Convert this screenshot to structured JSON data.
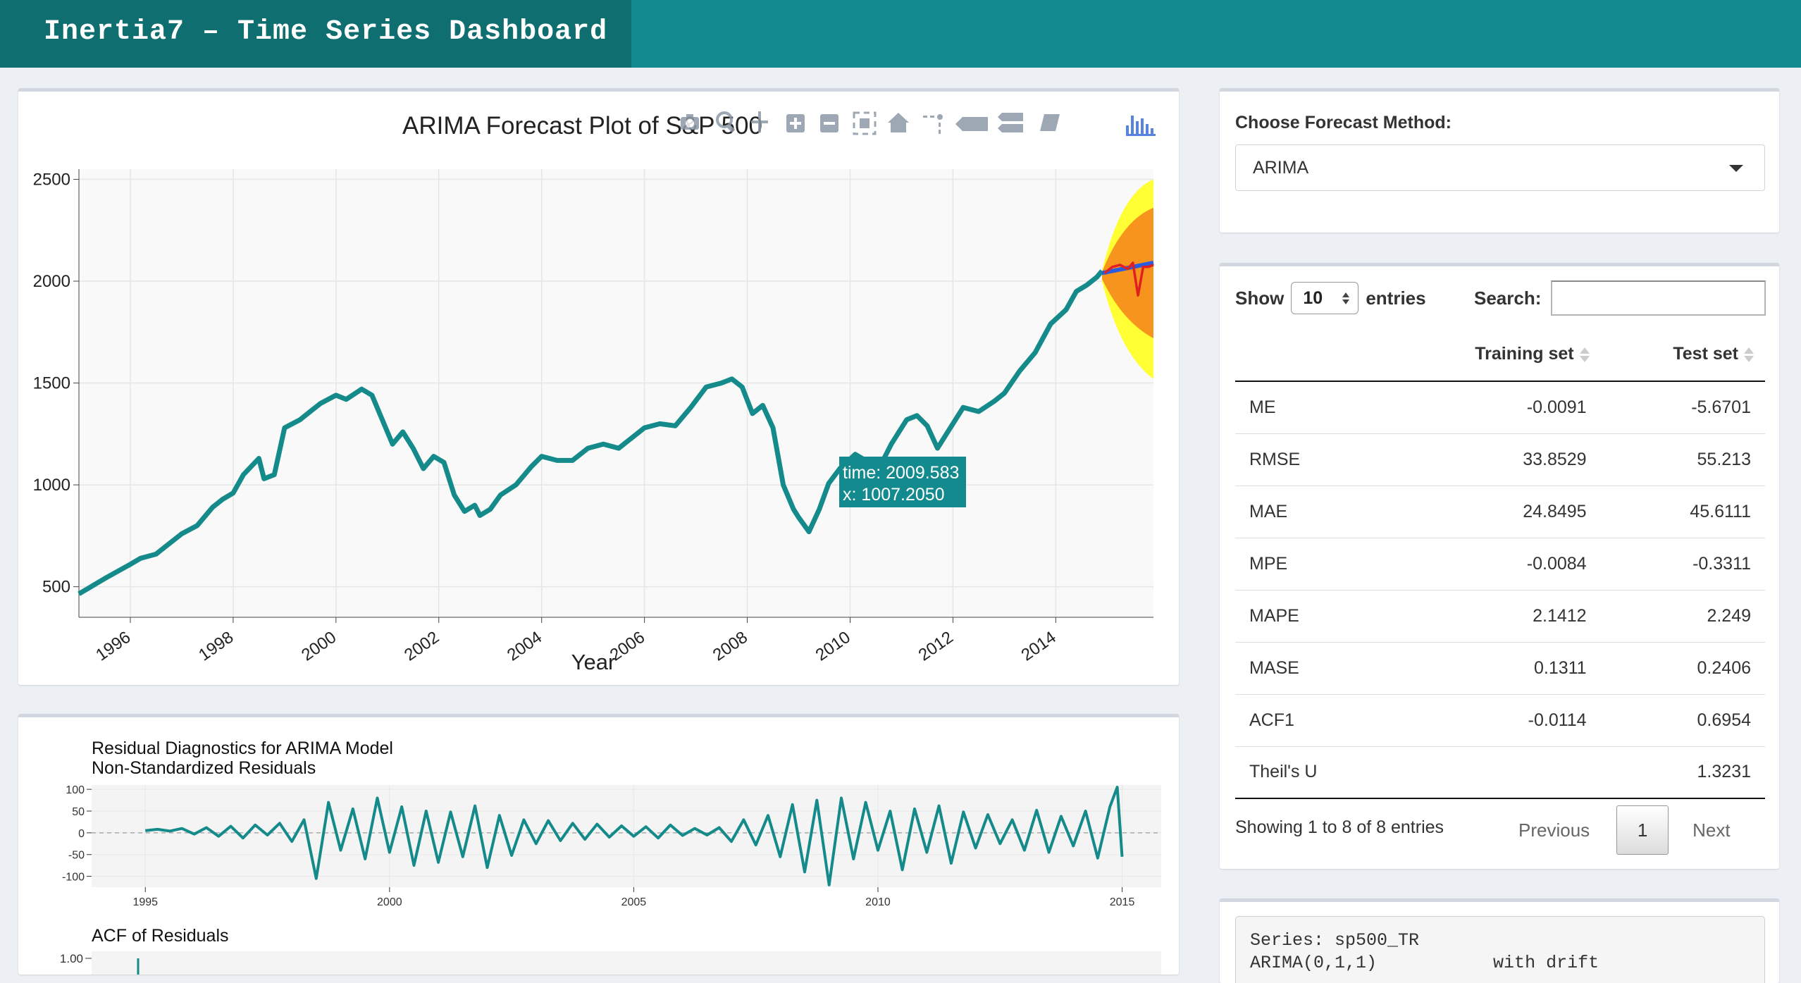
{
  "app": {
    "title": "Inertia7 – Time Series Dashboard"
  },
  "colors": {
    "header": "#138a8e",
    "brand": "#0f6e70",
    "series": "#148a8a",
    "forecast_mean": "#2b5ce0",
    "test_line": "#e02020",
    "band80": "#f7941d",
    "band95": "#ffff33"
  },
  "forecast_plot": {
    "title": "ARIMA Forecast Plot of S&P 500",
    "xlabel": "Year",
    "y_ticks": [
      "500",
      "1000",
      "1500",
      "2000",
      "2500"
    ],
    "x_ticks": [
      "1996",
      "1998",
      "2000",
      "2002",
      "2004",
      "2006",
      "2008",
      "2010",
      "2012",
      "2014"
    ],
    "tooltip": {
      "line1": "time: 2009.583",
      "line2": "x: 1007.2050"
    },
    "modebar": [
      "camera-icon",
      "zoom-icon",
      "pan-icon",
      "zoom-in-icon",
      "zoom-out-icon",
      "autoscale-icon",
      "home-icon",
      "spike-lines-icon",
      "hover-closest-icon",
      "hover-compare-icon",
      "show-data-icon",
      "plotly-logo-icon"
    ]
  },
  "chart_data": [
    {
      "type": "line",
      "title": "ARIMA Forecast Plot of S&P 500",
      "xlabel": "Year",
      "ylabel": "",
      "xlim": [
        1995,
        2015.9
      ],
      "ylim": [
        350,
        2550
      ],
      "grid": true,
      "series": [
        {
          "values_x": [
            1995.0,
            1995.5,
            1996.0,
            1996.2,
            1996.5,
            1996.7,
            1997.0,
            1997.3,
            1997.6,
            1997.8,
            1998.0,
            1998.2,
            1998.5,
            1998.6,
            1998.8,
            1999.0,
            1999.3,
            1999.5,
            1999.7,
            2000.0,
            2000.2,
            2000.5,
            2000.7,
            2000.9,
            2001.1,
            2001.3,
            2001.5,
            2001.7,
            2001.9,
            2002.1,
            2002.3,
            2002.5,
            2002.7,
            2002.8,
            2003.0,
            2003.2,
            2003.5,
            2003.8,
            2004.0,
            2004.3,
            2004.6,
            2004.9,
            2005.2,
            2005.5,
            2005.8,
            2006.0,
            2006.3,
            2006.6,
            2006.9,
            2007.2,
            2007.5,
            2007.7,
            2007.9,
            2008.1,
            2008.3,
            2008.5,
            2008.7,
            2008.9,
            2009.0,
            2009.2,
            2009.4,
            2009.583,
            2009.8,
            2010.1,
            2010.3,
            2010.5,
            2010.8,
            2011.1,
            2011.3,
            2011.5,
            2011.7,
            2011.9,
            2012.2,
            2012.5,
            2012.8,
            2013.0,
            2013.3,
            2013.6,
            2013.9,
            2014.2,
            2014.4,
            2014.6,
            2014.8,
            2014.9
          ],
          "values_y": [
            465,
            540,
            610,
            640,
            660,
            700,
            760,
            800,
            890,
            930,
            960,
            1050,
            1130,
            1030,
            1050,
            1280,
            1320,
            1360,
            1400,
            1440,
            1420,
            1470,
            1440,
            1320,
            1200,
            1260,
            1180,
            1080,
            1140,
            1110,
            950,
            870,
            900,
            850,
            880,
            950,
            1000,
            1090,
            1140,
            1120,
            1120,
            1180,
            1200,
            1180,
            1240,
            1280,
            1300,
            1290,
            1380,
            1480,
            1500,
            1520,
            1480,
            1350,
            1390,
            1280,
            1000,
            880,
            840,
            770,
            880,
            1007.2,
            1080,
            1150,
            1120,
            1050,
            1200,
            1320,
            1340,
            1290,
            1180,
            1260,
            1380,
            1360,
            1410,
            1450,
            1560,
            1650,
            1790,
            1860,
            1950,
            1980,
            2020,
            2050
          ],
          "name": ""
        },
        {
          "values_x": [
            2014.9,
            2015.3,
            2015.6,
            2015.9
          ],
          "values_y": [
            2040,
            2060,
            2075,
            2090
          ],
          "name": ""
        },
        {
          "values_x": [
            2014.95,
            2015.1,
            2015.25,
            2015.4,
            2015.5,
            2015.6,
            2015.7,
            2015.8,
            2015.9
          ],
          "values_y": [
            2040,
            2070,
            2080,
            2060,
            2090,
            1930,
            2070,
            2070,
            2080
          ],
          "name": ""
        }
      ]
    },
    {
      "type": "line",
      "title": "Residual Diagnostics for ARIMA Model",
      "subtitle": "Non-Standardized Residuals",
      "xlabel": "",
      "ylabel": "",
      "x_ticks": [
        1995,
        2000,
        2005,
        2010,
        2015
      ],
      "y_ticks": [
        100,
        50,
        0,
        -50,
        -100
      ],
      "xlim": [
        1993.9,
        2015.8
      ],
      "ylim": [
        -125,
        110
      ],
      "series": [
        {
          "values_x": [
            1995.0,
            1995.25,
            1995.5,
            1995.75,
            1996.0,
            1996.25,
            1996.5,
            1996.75,
            1997.0,
            1997.25,
            1997.5,
            1997.75,
            1998.0,
            1998.25,
            1998.5,
            1998.75,
            1999.0,
            1999.25,
            1999.5,
            1999.75,
            2000.0,
            2000.25,
            2000.5,
            2000.75,
            2001.0,
            2001.25,
            2001.5,
            2001.75,
            2002.0,
            2002.25,
            2002.5,
            2002.75,
            2003.0,
            2003.25,
            2003.5,
            2003.75,
            2004.0,
            2004.25,
            2004.5,
            2004.75,
            2005.0,
            2005.25,
            2005.5,
            2005.75,
            2006.0,
            2006.25,
            2006.5,
            2006.75,
            2007.0,
            2007.25,
            2007.5,
            2007.75,
            2008.0,
            2008.25,
            2008.5,
            2008.75,
            2009.0,
            2009.25,
            2009.5,
            2009.75,
            2010.0,
            2010.25,
            2010.5,
            2010.75,
            2011.0,
            2011.25,
            2011.5,
            2011.75,
            2012.0,
            2012.25,
            2012.5,
            2012.75,
            2013.0,
            2013.25,
            2013.5,
            2013.75,
            2014.0,
            2014.25,
            2014.5,
            2014.75,
            2014.9,
            2015.0
          ],
          "values_y": [
            5,
            8,
            4,
            10,
            -3,
            12,
            -8,
            15,
            -12,
            18,
            -5,
            22,
            -20,
            30,
            -105,
            70,
            -40,
            55,
            -60,
            80,
            -45,
            60,
            -75,
            50,
            -68,
            48,
            -55,
            62,
            -80,
            40,
            -52,
            30,
            -25,
            28,
            -18,
            22,
            -15,
            20,
            -10,
            16,
            -8,
            14,
            -12,
            18,
            -6,
            10,
            -5,
            12,
            -20,
            30,
            -28,
            40,
            -55,
            65,
            -90,
            75,
            -120,
            80,
            -60,
            70,
            -40,
            50,
            -85,
            55,
            -45,
            62,
            -70,
            48,
            -35,
            42,
            -25,
            30,
            -40,
            52,
            -45,
            38,
            -30,
            50,
            -58,
            60,
            105,
            -55
          ],
          "name": ""
        }
      ]
    }
  ],
  "residuals": {
    "title": "Residual Diagnostics for ARIMA Model",
    "subtitle": "Non-Standardized Residuals",
    "y_ticks": [
      "100",
      "50",
      "0",
      "-50",
      "-100"
    ],
    "x_ticks": [
      "1995",
      "2000",
      "2005",
      "2010",
      "2015"
    ],
    "acf_title": "ACF of Residuals",
    "acf_y_tick": "1.00"
  },
  "method": {
    "label": "Choose Forecast Method:",
    "selected": "ARIMA"
  },
  "table": {
    "show_label": "Show",
    "length_value": "10",
    "entries_label": "entries",
    "search_label": "Search:",
    "columns": [
      "",
      "Training set",
      "Test set"
    ],
    "rows": [
      [
        "ME",
        "-0.0091",
        "-5.6701"
      ],
      [
        "RMSE",
        "33.8529",
        "55.213"
      ],
      [
        "MAE",
        "24.8495",
        "45.6111"
      ],
      [
        "MPE",
        "-0.0084",
        "-0.3311"
      ],
      [
        "MAPE",
        "2.1412",
        "2.249"
      ],
      [
        "MASE",
        "0.1311",
        "0.2406"
      ],
      [
        "ACF1",
        "-0.0114",
        "0.6954"
      ],
      [
        "Theil's U",
        "",
        "1.3231"
      ]
    ],
    "info": "Showing 1 to 8 of 8 entries",
    "previous": "Previous",
    "page": "1",
    "next": "Next"
  },
  "summary": {
    "line1": "Series: sp500_TR",
    "line2": "ARIMA(0,1,1)           with drift"
  }
}
